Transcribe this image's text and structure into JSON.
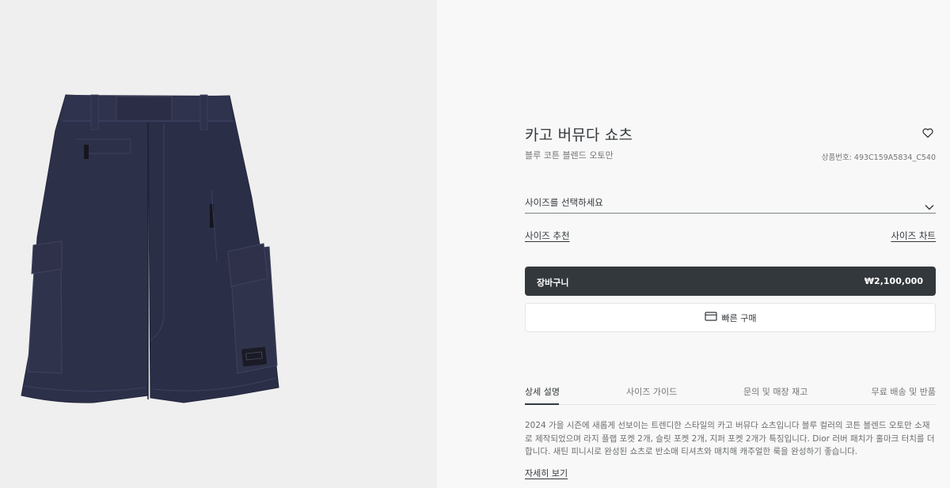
{
  "product": {
    "name": "카고 버뮤다 쇼츠",
    "subtitle": "블루 코튼 블렌드 오토만",
    "reference": "상품번호: 493C159A5834_C540",
    "image": "navy cargo bermuda shorts"
  },
  "size": {
    "placeholder": "사이즈를 선택하세요",
    "recommend_label": "사이즈 추천",
    "chart_label": "사이즈 차트"
  },
  "buttons": {
    "cart_label": "장바구니",
    "price": "₩2,100,000",
    "quick_buy_label": "빠른 구매"
  },
  "tabs": [
    {
      "label": "상세 설명",
      "active": true
    },
    {
      "label": "사이즈 가이드",
      "active": false
    },
    {
      "label": "문의 및 매장 재고",
      "active": false
    },
    {
      "label": "무료 배송 및 반품",
      "active": false
    }
  ],
  "description": {
    "text": "2024 가을 시즌에 새롭게 선보이는 트렌디한 스타일의 카고 버뮤다 쇼츠입니다 블루 컬러의 코튼 블렌드 오토만 소재로 제작되었으며 라지 플랩 포켓 2개, 슬릿 포켓 2개, 지퍼 포켓 2개가 특징입니다. Dior 러버 패치가 홀마크 터치를 더합니다. 새틴 피니시로 완성된 쇼츠로 반소매 티셔츠와 매치해 캐주얼한 룩을 완성하기 좋습니다.",
    "more_label": "자세히 보기"
  },
  "icons": {
    "wishlist": "heart-icon",
    "dropdown": "chevron-down-icon",
    "quick_buy": "credit-card-icon"
  },
  "colors": {
    "primary": "#33383c",
    "product_navy": "#2c2f4a"
  }
}
